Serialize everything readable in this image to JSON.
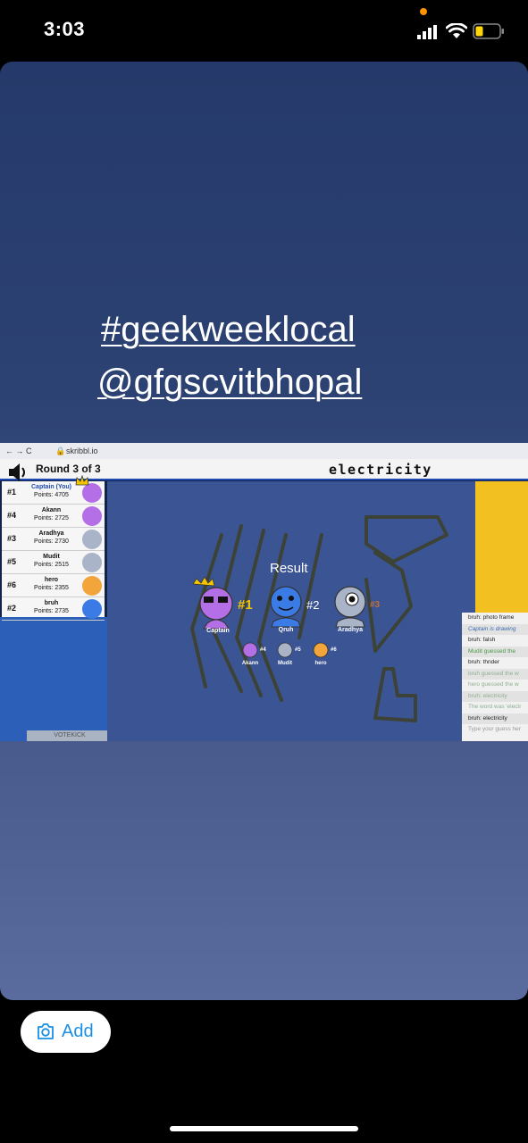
{
  "status": {
    "time": "3:03"
  },
  "story": {
    "hashtag": "#geekweeklocal",
    "mention": "@gfgscvitbhopal"
  },
  "photo": {
    "browser": {
      "nav": "← → C",
      "url": "skribbl.io"
    },
    "game": {
      "round": "Round 3 of 3",
      "word": "electricity",
      "result_label": "Result",
      "vote_kick": "VOTEKICK",
      "players": [
        {
          "rank": "#1",
          "name": "Captain (You)",
          "points": "Points: 4705",
          "color": "#b46ee6"
        },
        {
          "rank": "#4",
          "name": "Akann",
          "points": "Points: 2725",
          "color": "#b46ee6"
        },
        {
          "rank": "#3",
          "name": "Aradhya",
          "points": "Points: 2730",
          "color": "#aab4c8"
        },
        {
          "rank": "#5",
          "name": "Mudit",
          "points": "Points: 2515",
          "color": "#aab4c8"
        },
        {
          "rank": "#6",
          "name": "hero",
          "points": "Points: 2355",
          "color": "#f2a53a"
        },
        {
          "rank": "#2",
          "name": "bruh",
          "points": "Points: 2735",
          "color": "#3b7be6"
        }
      ],
      "winners": [
        {
          "rank": "#1",
          "name": "Captain"
        },
        {
          "rank": "#2",
          "name": "Qruh"
        },
        {
          "rank": "#3",
          "name": "Aradhya"
        }
      ],
      "others": [
        {
          "rank": "#4",
          "name": "Akann"
        },
        {
          "rank": "#5",
          "name": "Mudit"
        },
        {
          "rank": "#6",
          "name": "hero"
        }
      ],
      "chat": [
        {
          "text": "bruh: photo frame",
          "style": "normal"
        },
        {
          "text": "Captain is drawing",
          "style": "blue"
        },
        {
          "text": "bruh: falsh",
          "style": "normal"
        },
        {
          "text": "Mudit guessed the",
          "style": "green"
        },
        {
          "text": "bruh: thnder",
          "style": "normal"
        },
        {
          "text": "bruh guessed the w",
          "style": "faded"
        },
        {
          "text": "hero guessed the w",
          "style": "faded"
        },
        {
          "text": "bruh: electricity",
          "style": "faded"
        },
        {
          "text": "The word was 'electr",
          "style": "faded"
        },
        {
          "text": "bruh: electricity",
          "style": "normal"
        },
        {
          "text": "Type your guess her",
          "style": "gray"
        }
      ]
    }
  },
  "actions": {
    "add_label": "Add"
  }
}
